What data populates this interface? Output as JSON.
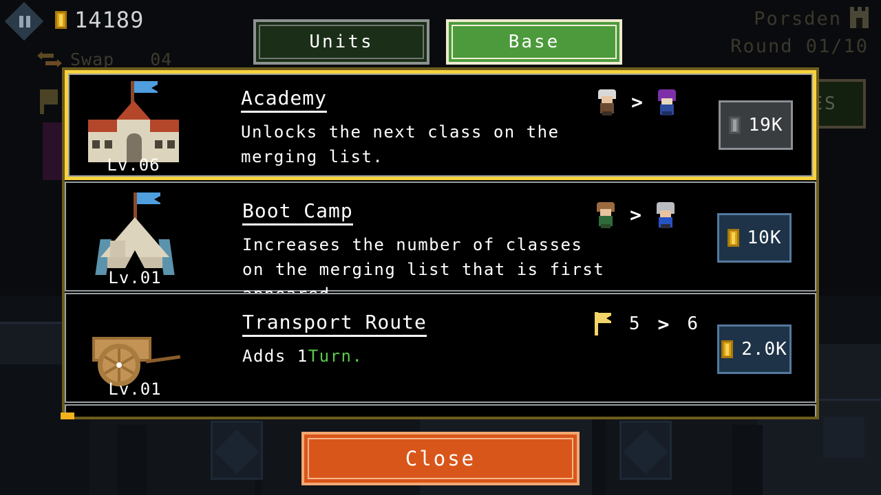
{
  "hud": {
    "pause_icon": "pause-icon",
    "gold": "14189",
    "gold_icon": "coin-icon",
    "swap_label": "Swap",
    "swap_count": "04",
    "swap_icon": "swap-arrows-icon",
    "location": "Porsden",
    "location_icon": "castle-icon",
    "round": "Round 01/10"
  },
  "tabs": [
    {
      "label": "Units",
      "active": false
    },
    {
      "label": "Base",
      "active": true
    }
  ],
  "background": {
    "hidden_button_label": "ES"
  },
  "items": [
    {
      "name": "Academy",
      "level": "Lv.06",
      "desc_pre": "Unlocks the next class on the merging list.",
      "desc_value": "",
      "desc_post": "",
      "icon": "academy-building-icon",
      "effect_type": "units",
      "effect_from": "unit-sprite-white-hair",
      "effect_to": "unit-sprite-purple-turban",
      "effect_arrow": ">",
      "price": "19K",
      "affordable": false,
      "selected": true
    },
    {
      "name": "Boot Camp",
      "level": "Lv.01",
      "desc_pre": "Increases the number of classes on the merging list that is first appeared.",
      "desc_value": "",
      "desc_post": "",
      "icon": "boot-camp-tent-icon",
      "effect_type": "units",
      "effect_from": "unit-sprite-green-shirt",
      "effect_to": "unit-sprite-gray-hair-blue",
      "effect_arrow": ">",
      "price": "10K",
      "affordable": true,
      "selected": false
    },
    {
      "name": "Transport Route",
      "level": "Lv.01",
      "desc_pre": "Adds 1",
      "desc_value": "Turn.",
      "desc_post": "",
      "icon": "transport-cart-icon",
      "effect_type": "numbers",
      "effect_icon": "flag-icon",
      "effect_from": "5",
      "effect_to": "6",
      "effect_arrow": ">",
      "price": "2.0K",
      "affordable": true,
      "selected": false
    }
  ],
  "footer": {
    "close_label": "Close"
  },
  "colors": {
    "accent_yellow": "#f7d33c",
    "panel_border": "#6d5c1c",
    "tab_active": "#4c9a3c",
    "close_button": "#d9561a",
    "price_buy": "#1e3348",
    "price_disabled": "#3a3d40",
    "highlight_green": "#5bc94a"
  }
}
